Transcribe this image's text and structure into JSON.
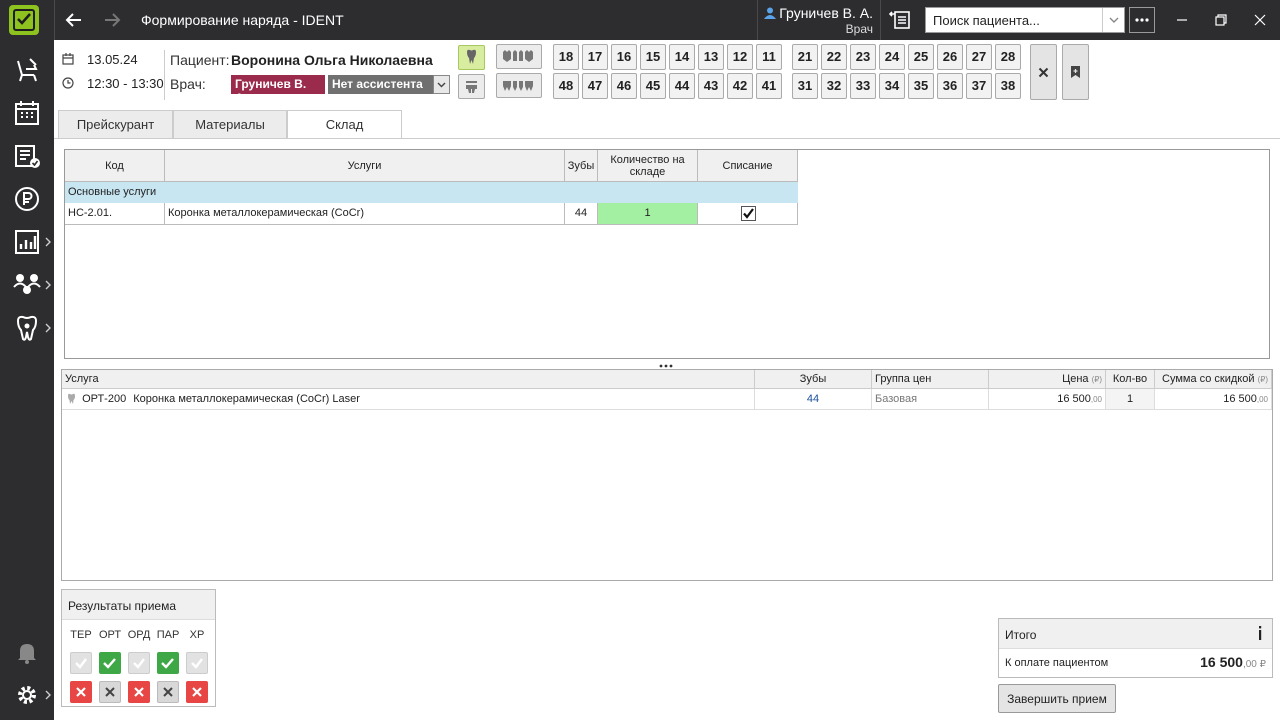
{
  "window": {
    "title": "Формирование наряда - IDENT"
  },
  "user": {
    "name": "Груничев В. А.",
    "role": "Врач"
  },
  "search": {
    "placeholder": "Поиск пациента..."
  },
  "header": {
    "date": "13.05.24",
    "time": "12:30 - 13:30",
    "patient_label": "Пациент:",
    "patient_name": "Воронина Ольга Николаевна",
    "doctor_label": "Врач:",
    "doctor_name": "Груничев В. А.",
    "assistant": "Нет ассистента"
  },
  "teeth": {
    "upper_right": [
      "18",
      "17",
      "16",
      "15",
      "14",
      "13",
      "12",
      "11"
    ],
    "upper_left": [
      "21",
      "22",
      "23",
      "24",
      "25",
      "26",
      "27",
      "28"
    ],
    "lower_right": [
      "48",
      "47",
      "46",
      "45",
      "44",
      "43",
      "42",
      "41"
    ],
    "lower_left": [
      "31",
      "32",
      "33",
      "34",
      "35",
      "36",
      "37",
      "38"
    ]
  },
  "tabs": [
    {
      "label": "Прейскурант",
      "active": false
    },
    {
      "label": "Материалы",
      "active": false
    },
    {
      "label": "Склад",
      "active": true
    }
  ],
  "stock_table": {
    "columns": [
      "Код",
      "Услуги",
      "Зубы",
      "Количество на складе",
      "Списание"
    ],
    "group": "Основные услуги",
    "rows": [
      {
        "code": "НС-2.01.",
        "service": "Коронка металлокерамическая (CoCr)",
        "teeth": "44",
        "stock": "1",
        "writeoff": true
      }
    ]
  },
  "services_table": {
    "columns": [
      "Услуга",
      "Зубы",
      "Группа цен",
      "Цена",
      "Кол-во",
      "Сумма со скидкой"
    ],
    "currency": "(₽)",
    "rows": [
      {
        "code": "ОРТ-200",
        "name": "Коронка металлокерамическая (CoCr) Laser",
        "teeth": "44",
        "price_group": "Базовая",
        "price": "16 500",
        "price_cents": ",00",
        "qty": "1",
        "sum": "16 500",
        "sum_cents": ",00"
      }
    ]
  },
  "results": {
    "title": "Результаты приема",
    "labels": [
      "ТЕР",
      "ОРТ",
      "ОРД",
      "ПАР",
      "ХР"
    ],
    "approved": [
      false,
      true,
      false,
      true,
      false
    ],
    "rejected": [
      true,
      false,
      true,
      false,
      true
    ]
  },
  "total": {
    "title": "Итого",
    "label": "К оплате пациентом",
    "amount": "16 500",
    "cents": ",00 ₽"
  },
  "finish_button": "Завершить прием",
  "colors": {
    "accent": "#8dc21f",
    "doctor_chip": "#9b2b4c",
    "approve": "#3fa846",
    "reject": "#e84545",
    "group_row": "#c8e6f2",
    "stock_cell": "#a3f0a3"
  }
}
